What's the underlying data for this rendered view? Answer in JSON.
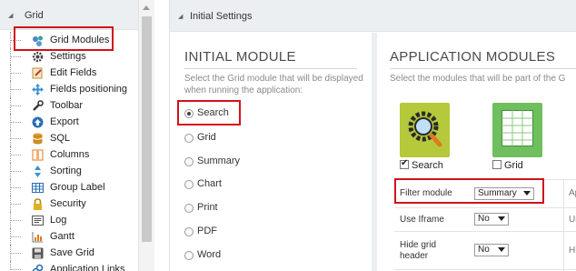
{
  "tree": {
    "title": "Grid",
    "items": [
      {
        "label": "Grid Modules",
        "icon": "grid-modules-icon"
      },
      {
        "label": "Settings",
        "icon": "gear-icon"
      },
      {
        "label": "Edit Fields",
        "icon": "edit-fields-icon"
      },
      {
        "label": "Fields positioning",
        "icon": "move-arrows-icon"
      },
      {
        "label": "Toolbar",
        "icon": "wrench-icon"
      },
      {
        "label": "Export",
        "icon": "export-icon"
      },
      {
        "label": "SQL",
        "icon": "database-icon"
      },
      {
        "label": "Columns",
        "icon": "columns-icon"
      },
      {
        "label": "Sorting",
        "icon": "sort-icon"
      },
      {
        "label": "Group Label",
        "icon": "table-icon"
      },
      {
        "label": "Security",
        "icon": "lock-icon"
      },
      {
        "label": "Log",
        "icon": "log-icon"
      },
      {
        "label": "Gantt",
        "icon": "gantt-chart-icon"
      },
      {
        "label": "Save Grid",
        "icon": "save-icon"
      },
      {
        "label": "Application Links",
        "icon": "link-icon"
      }
    ]
  },
  "settings": {
    "title": "Initial Settings",
    "initial_module": {
      "title": "INITIAL MODULE",
      "description": "Select the Grid module that will be displayed when running the application:",
      "options": [
        "Search",
        "Grid",
        "Summary",
        "Chart",
        "Print",
        "PDF",
        "Word"
      ],
      "selected": "Search"
    },
    "app_modules": {
      "title": "APPLICATION MODULES",
      "description": "Select the modules that will be part of the G",
      "modules": [
        {
          "label": "Search",
          "checked": true,
          "icon": "search-module-icon"
        },
        {
          "label": "Grid",
          "checked": false,
          "icon": "grid-module-icon"
        }
      ],
      "props": [
        {
          "label": "Filter module",
          "value": "Summary",
          "extra": "Appli"
        },
        {
          "label": "Use Iframe",
          "value": "No",
          "extra": "Use I"
        },
        {
          "label": "Hide grid header",
          "value": "No",
          "extra": "Hide"
        }
      ]
    }
  },
  "colors": {
    "highlight": "#d0121b",
    "header_bg": "#eceff2",
    "search_card": "#b5c93a",
    "grid_card": "#6fbf5e"
  }
}
